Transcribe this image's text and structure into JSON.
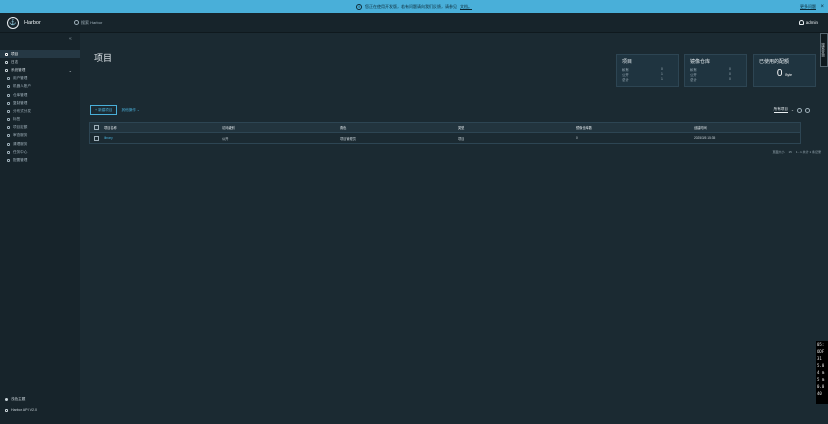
{
  "banner": {
    "message": "您正在使用开发版，若有问题请向我们反馈，请参见",
    "doc_link": "文档。",
    "more_link": "更多问题",
    "close": "×"
  },
  "header": {
    "brand": "Harbor",
    "search_placeholder": "搜索 Harbor",
    "user": "admin",
    "side_tab": "搜索查询"
  },
  "sidebar": {
    "collapse": "«",
    "items": [
      {
        "label": "项目",
        "active": true
      },
      {
        "label": "日志"
      },
      {
        "label": "系统管理",
        "chevron": "⌄"
      },
      {
        "label": "用户管理",
        "child": true
      },
      {
        "label": "机器人账户",
        "child": true
      },
      {
        "label": "仓库管理",
        "child": true
      },
      {
        "label": "复制管理",
        "child": true
      },
      {
        "label": "分布式分发",
        "child": true
      },
      {
        "label": "标签",
        "child": true
      },
      {
        "label": "项目定额",
        "child": true
      },
      {
        "label": "审查服务",
        "child": true
      },
      {
        "label": "清理服务",
        "child": true
      },
      {
        "label": "任务中心",
        "child": true
      },
      {
        "label": "配置管理",
        "child": true
      }
    ],
    "theme": "浅色主题",
    "api": "Harbor API V2.0"
  },
  "main": {
    "title": "项目",
    "cards": {
      "projects": {
        "title": "项目",
        "rows": [
          [
            "私有",
            "0"
          ],
          [
            "公开",
            "1"
          ],
          [
            "总计",
            "1"
          ]
        ]
      },
      "repos": {
        "title": "镜像仓库",
        "rows": [
          [
            "私有",
            "0"
          ],
          [
            "公开",
            "0"
          ],
          [
            "总计",
            "0"
          ]
        ]
      },
      "quota": {
        "title": "已使用的配额",
        "value": "0",
        "unit": "Byte"
      }
    },
    "toolbar": {
      "new_project": "+ 新建项目",
      "more": "其他操作 ⌄"
    },
    "filter": {
      "label": "所有项目",
      "chevron": "⌄"
    },
    "table": {
      "headers": [
        "项目名称",
        "访问级别",
        "角色",
        "类型",
        "镜像仓库数",
        "创建时间"
      ],
      "rows": [
        [
          "library",
          "公开",
          "项目管理员",
          "项目",
          "0",
          "2025/3/5 15:35"
        ]
      ]
    },
    "pager": {
      "page_size_label": "页面大小",
      "page_size": "15",
      "range": "1 - 1 共计 1 条记录"
    }
  },
  "terminal": {
    "lines": [
      "05:",
      "ODF",
      "31 ",
      "5.0",
      "4 m",
      "5 m",
      "0.0",
      "40 "
    ]
  }
}
